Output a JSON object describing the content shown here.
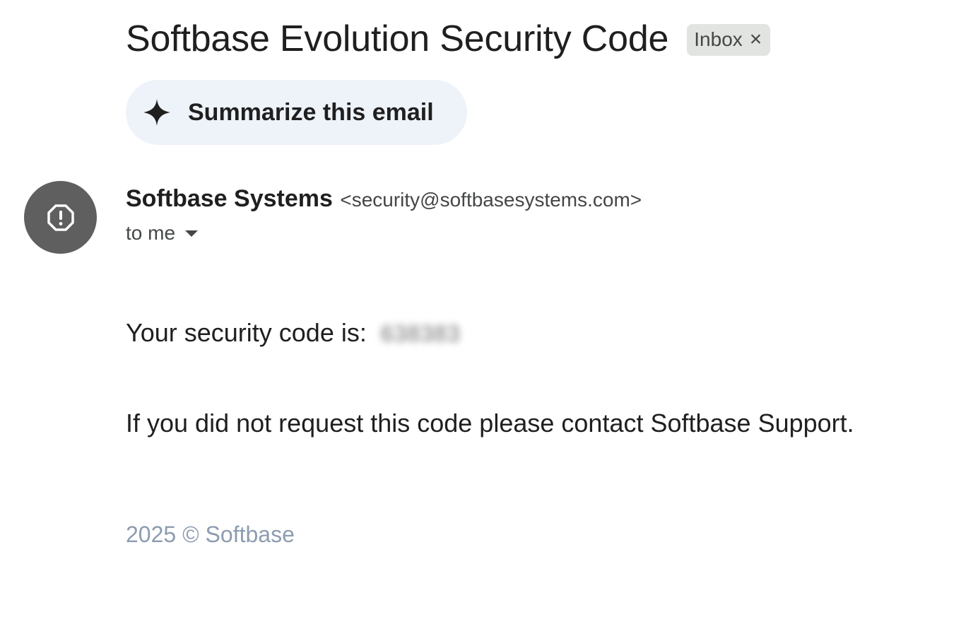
{
  "email": {
    "subject": "Softbase Evolution Security Code",
    "label_chip": {
      "text": "Inbox",
      "remove_glyph": "×"
    },
    "summarize_button": {
      "label": "Summarize this email",
      "icon": "sparkle-icon"
    },
    "sender": {
      "name": "Softbase Systems",
      "email": "<security@softbasesystems.com>",
      "avatar_icon": "warning-octagon-icon"
    },
    "recipient": {
      "text": "to me"
    },
    "body": {
      "code_prefix": "Your security code is:",
      "code_value": "638383",
      "notice": "If you did not request this code please contact Softbase Support.",
      "footer": "2025 © Softbase"
    }
  },
  "colors": {
    "summarize_bg": "#eef2f9",
    "chip_bg": "#e2e4e1",
    "avatar_bg": "#5f5f5f",
    "footer_text": "#8d9cb0"
  }
}
